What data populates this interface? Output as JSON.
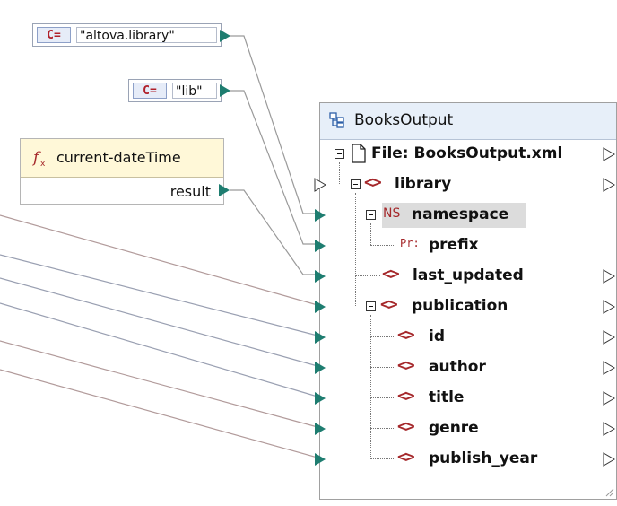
{
  "constants": [
    {
      "tag": "C=",
      "value": "\"altova.library\""
    },
    {
      "tag": "C=",
      "value": "\"lib\""
    }
  ],
  "function": {
    "name": "current-dateTime",
    "output": "result",
    "icon": "function-icon"
  },
  "component": {
    "title": "BooksOutput",
    "file_label": "File: BooksOutput.xml",
    "nodes": {
      "library": "library",
      "namespace_tag": "NS",
      "namespace": "namespace",
      "prefix_tag": "Pr:",
      "prefix": "prefix",
      "last_updated": "last_updated",
      "publication": "publication",
      "id": "id",
      "author": "author",
      "title": "title",
      "genre": "genre",
      "publish_year": "publish_year"
    }
  },
  "colors": {
    "connector": "#1e7d70",
    "element_icon": "#a5282b",
    "function_header": "#fff8d8",
    "component_header": "#e7eff9",
    "wire": "#8a8a8a",
    "wire_muted": "#b08a8a"
  }
}
